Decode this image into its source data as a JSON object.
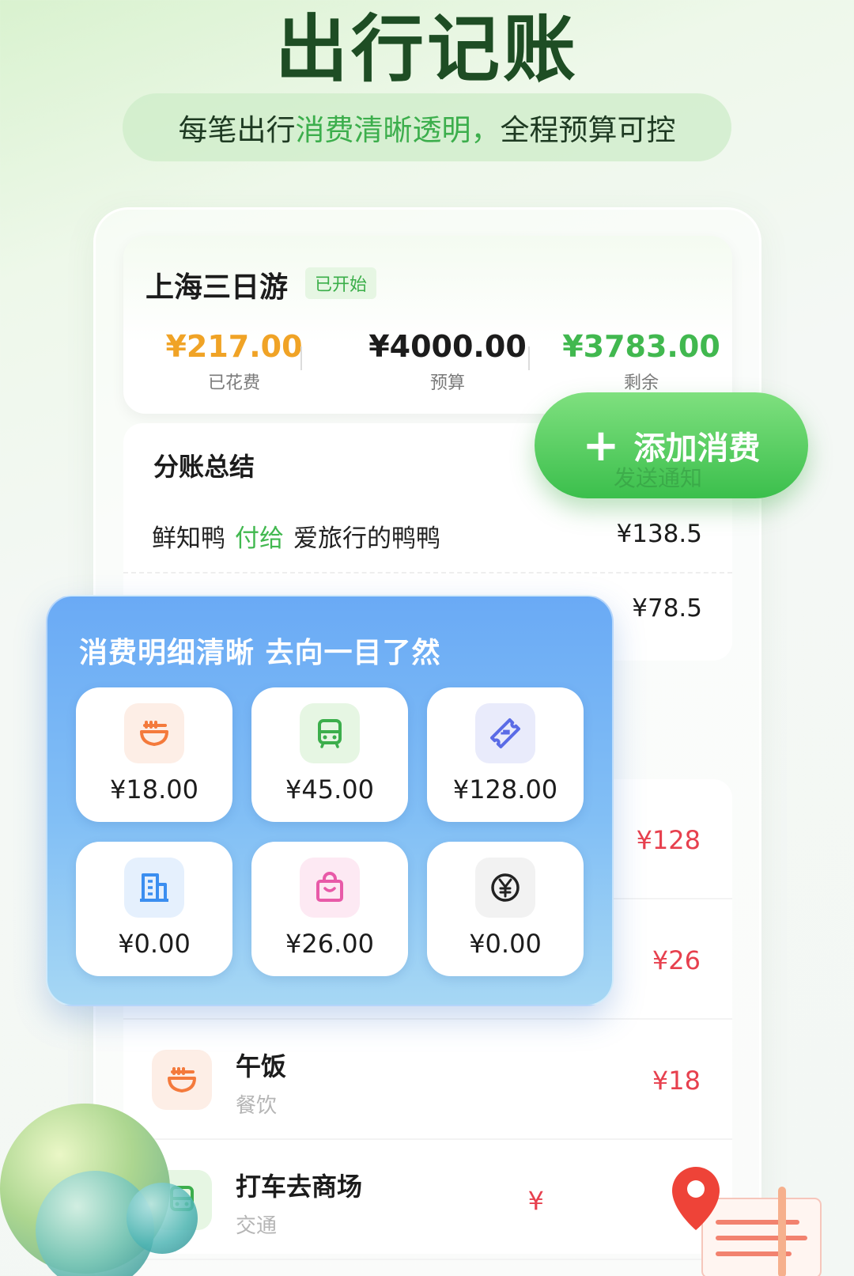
{
  "hero": {
    "title": "出行记账",
    "subtitle_plain": "每笔出行",
    "subtitle_highlight": "消费清晰透明，",
    "subtitle_tail": "全程预算可控"
  },
  "trip": {
    "name": "上海三日游",
    "status": "已开始",
    "spent_value": "¥217.00",
    "spent_label": "已花费",
    "budget_value": "¥4000.00",
    "budget_label": "预算",
    "remaining_value": "¥3783.00",
    "remaining_label": "剩余"
  },
  "add_button": {
    "label": "添加消费",
    "icon": "plus-icon"
  },
  "ghost_text": "发送通知",
  "split": {
    "title": "分账总结",
    "row1": {
      "payer": "鲜知鸭",
      "action": "付给",
      "payee": "爱旅行的鸭鸭",
      "amount": "¥138.5"
    },
    "row2": {
      "amount": "¥78.5"
    }
  },
  "overlay": {
    "title": "消费明细清晰  去向一目了然",
    "tiles": [
      {
        "icon": "noodle-bowl-icon",
        "amount": "¥18.00",
        "color": "#f47a3c",
        "bg": "#fdeee6"
      },
      {
        "icon": "bus-icon",
        "amount": "¥45.00",
        "color": "#3cae4c",
        "bg": "#e6f6e3"
      },
      {
        "icon": "ticket-icon",
        "amount": "¥128.00",
        "color": "#5a6be6",
        "bg": "#e9ebfb"
      },
      {
        "icon": "building-icon",
        "amount": "¥0.00",
        "color": "#3b8ef0",
        "bg": "#e5f0fd"
      },
      {
        "icon": "shopping-bag-icon",
        "amount": "¥26.00",
        "color": "#e85aa8",
        "bg": "#fde9f3"
      },
      {
        "icon": "yen-coin-icon",
        "amount": "¥0.00",
        "color": "#222222",
        "bg": "#f2f2f2"
      }
    ]
  },
  "expenses": [
    {
      "amount": "¥128"
    },
    {
      "amount": "¥26"
    },
    {
      "name": "午饭",
      "category": "餐饮",
      "amount": "¥18",
      "icon": "noodle-bowl-icon"
    },
    {
      "name": "打车去商场",
      "category": "交通",
      "amount": "¥",
      "icon": "bus-icon"
    }
  ],
  "colors": {
    "brand_green": "#41b84f",
    "spent_orange": "#f0a326",
    "expense_red": "#e7404e",
    "overlay_blue": "#6aaaf5"
  }
}
